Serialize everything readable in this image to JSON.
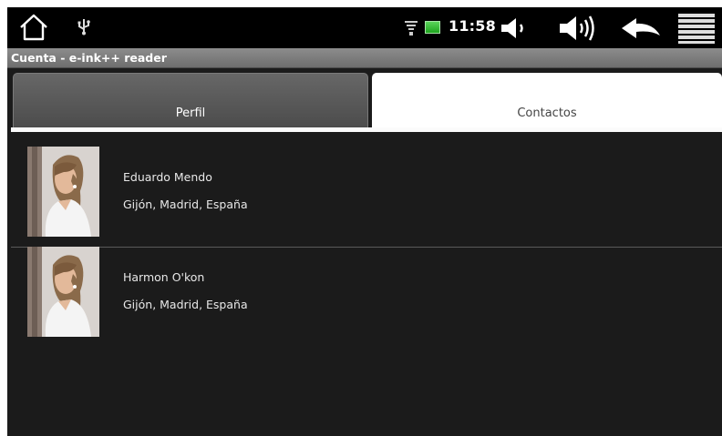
{
  "status_bar": {
    "time": "11:58",
    "icons": [
      "home-icon",
      "usb-icon",
      "wifi-icon",
      "battery-icon",
      "volume-down-icon",
      "volume-up-icon",
      "back-icon",
      "menu-icon"
    ],
    "battery_color": "#2ebd2e"
  },
  "title_bar": {
    "title": "Cuenta - e-ink++ reader"
  },
  "tabs": [
    {
      "label": "Perfil",
      "selected": false
    },
    {
      "label": "Contactos",
      "selected": true
    }
  ],
  "contacts": [
    {
      "name": "Eduardo Mendo",
      "location": "Gijón, Madrid, España",
      "avatar": "profile-photo"
    },
    {
      "name": "Harmon O'kon",
      "location": "Gijón, Madrid, España",
      "avatar": "profile-photo"
    }
  ],
  "colors": {
    "background": "#1b1b1b",
    "status_bar": "#000000",
    "title_bar": "#7c7c7c",
    "tab_selected": "#ffffff",
    "tab_unselected": "#5a5a5a"
  }
}
